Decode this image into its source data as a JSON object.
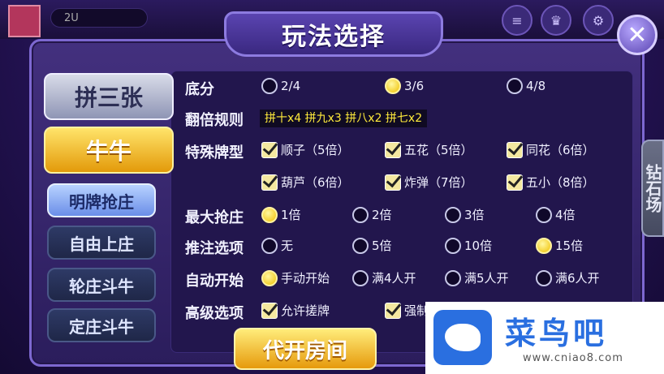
{
  "header": {
    "coin_value": "2U",
    "top_icons": [
      "menu-icon",
      "trophy-icon",
      "gear-icon",
      "help-icon"
    ]
  },
  "dialog": {
    "title": "玩法选择",
    "close_icon": "close-icon"
  },
  "games": [
    {
      "label": "拼三张",
      "active": false
    },
    {
      "label": "牛牛",
      "active": true
    }
  ],
  "modes": [
    {
      "label": "明牌抢庄",
      "active": true
    },
    {
      "label": "自由上庄",
      "active": false
    },
    {
      "label": "轮庄斗牛",
      "active": false
    },
    {
      "label": "定庄斗牛",
      "active": false
    }
  ],
  "settings": {
    "base_score": {
      "label": "底分",
      "options": [
        {
          "label": "2/4",
          "selected": false
        },
        {
          "label": "3/6",
          "selected": true
        },
        {
          "label": "4/8",
          "selected": false
        }
      ]
    },
    "double_rule": {
      "label": "翻倍规则",
      "text": "拼十x4 拼九x3 拼八x2 拼七x2"
    },
    "special_hands": {
      "label": "特殊牌型",
      "options": [
        {
          "label": "顺子（5倍）",
          "checked": true
        },
        {
          "label": "五花（5倍）",
          "checked": true
        },
        {
          "label": "同花（6倍）",
          "checked": true
        },
        {
          "label": "葫芦（6倍）",
          "checked": true
        },
        {
          "label": "炸弹（7倍）",
          "checked": true
        },
        {
          "label": "五小（8倍）",
          "checked": true
        }
      ]
    },
    "max_bid": {
      "label": "最大抢庄",
      "options": [
        {
          "label": "1倍",
          "selected": true
        },
        {
          "label": "2倍",
          "selected": false
        },
        {
          "label": "3倍",
          "selected": false
        },
        {
          "label": "4倍",
          "selected": false
        }
      ]
    },
    "push_bet": {
      "label": "推注选项",
      "options": [
        {
          "label": "无",
          "selected": false
        },
        {
          "label": "5倍",
          "selected": false
        },
        {
          "label": "10倍",
          "selected": false
        },
        {
          "label": "15倍",
          "selected": true
        }
      ]
    },
    "auto_start": {
      "label": "自动开始",
      "options": [
        {
          "label": "手动开始",
          "selected": true
        },
        {
          "label": "满4人开",
          "selected": false
        },
        {
          "label": "满5人开",
          "selected": false
        },
        {
          "label": "满6人开",
          "selected": false
        }
      ]
    },
    "advanced": {
      "label": "高级选项",
      "options": [
        {
          "label": "允许搓牌",
          "checked": true
        },
        {
          "label": "强制",
          "checked": true
        }
      ]
    }
  },
  "buttons": {
    "open_room": "代开房间",
    "side_market": "钻石场"
  },
  "watermark": {
    "name": "菜鸟吧",
    "url": "www.cniao8.com"
  }
}
